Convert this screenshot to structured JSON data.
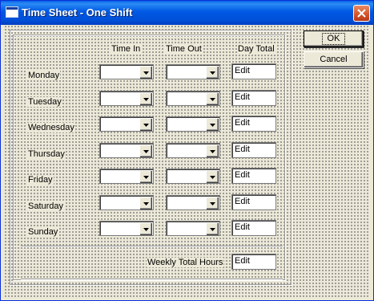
{
  "window": {
    "title": "Time Sheet - One Shift",
    "title_color": "#0058e3"
  },
  "columns": {
    "time_in": "Time In",
    "time_out": "Time Out",
    "day_total": "Day Total"
  },
  "days": [
    {
      "label": "Monday",
      "time_in": "",
      "time_out": "",
      "total": "Edit"
    },
    {
      "label": "Tuesday",
      "time_in": "",
      "time_out": "",
      "total": "Edit"
    },
    {
      "label": "Wednesday",
      "time_in": "",
      "time_out": "",
      "total": "Edit"
    },
    {
      "label": "Thursday",
      "time_in": "",
      "time_out": "",
      "total": "Edit"
    },
    {
      "label": "Friday",
      "time_in": "",
      "time_out": "",
      "total": "Edit"
    },
    {
      "label": "Saturday",
      "time_in": "",
      "time_out": "",
      "total": "Edit"
    },
    {
      "label": "Sunday",
      "time_in": "",
      "time_out": "",
      "total": "Edit"
    }
  ],
  "weekly": {
    "label": "Weekly Total Hours",
    "value": "Edit"
  },
  "buttons": {
    "ok": "OK",
    "cancel": "Cancel"
  },
  "icons": {
    "window": "app-window-icon",
    "close": "close-icon",
    "dropdown": "chevron-down-icon"
  }
}
